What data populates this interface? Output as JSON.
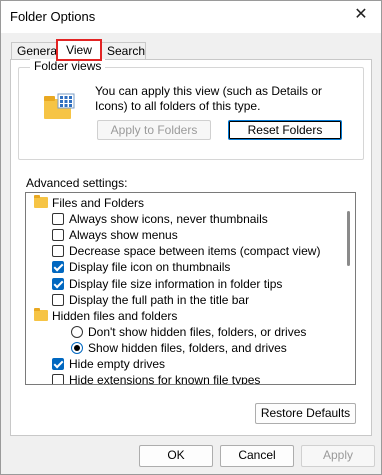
{
  "window": {
    "title": "Folder Options",
    "close_glyph": "✕"
  },
  "tabs": [
    {
      "label": "General"
    },
    {
      "label": "View"
    },
    {
      "label": "Search"
    }
  ],
  "folder_views": {
    "legend": "Folder views",
    "description": "You can apply this view (such as Details or Icons) to all folders of this type.",
    "apply_button": "Apply to Folders",
    "reset_button": "Reset Folders"
  },
  "advanced": {
    "label": "Advanced settings:",
    "items": [
      {
        "type": "folder",
        "label": "Files and Folders"
      },
      {
        "type": "checkbox",
        "checked": false,
        "label": "Always show icons, never thumbnails"
      },
      {
        "type": "checkbox",
        "checked": false,
        "label": "Always show menus"
      },
      {
        "type": "checkbox",
        "checked": false,
        "label": "Decrease space between items (compact view)"
      },
      {
        "type": "checkbox",
        "checked": true,
        "label": "Display file icon on thumbnails"
      },
      {
        "type": "checkbox",
        "checked": true,
        "label": "Display file size information in folder tips"
      },
      {
        "type": "checkbox",
        "checked": false,
        "label": "Display the full path in the title bar"
      },
      {
        "type": "folder",
        "label": "Hidden files and folders"
      },
      {
        "type": "radio",
        "checked": false,
        "label": "Don't show hidden files, folders, or drives"
      },
      {
        "type": "radio",
        "checked": true,
        "label": "Show hidden files, folders, and drives"
      },
      {
        "type": "checkbox",
        "checked": true,
        "label": "Hide empty drives"
      },
      {
        "type": "checkbox",
        "checked": false,
        "label": "Hide extensions for known file types"
      }
    ]
  },
  "buttons": {
    "restore_defaults": "Restore Defaults",
    "ok": "OK",
    "cancel": "Cancel",
    "apply": "Apply"
  },
  "colors": {
    "accent": "#0067c0",
    "highlight_border": "#e22424",
    "folder_yellow": "#f6c445"
  }
}
